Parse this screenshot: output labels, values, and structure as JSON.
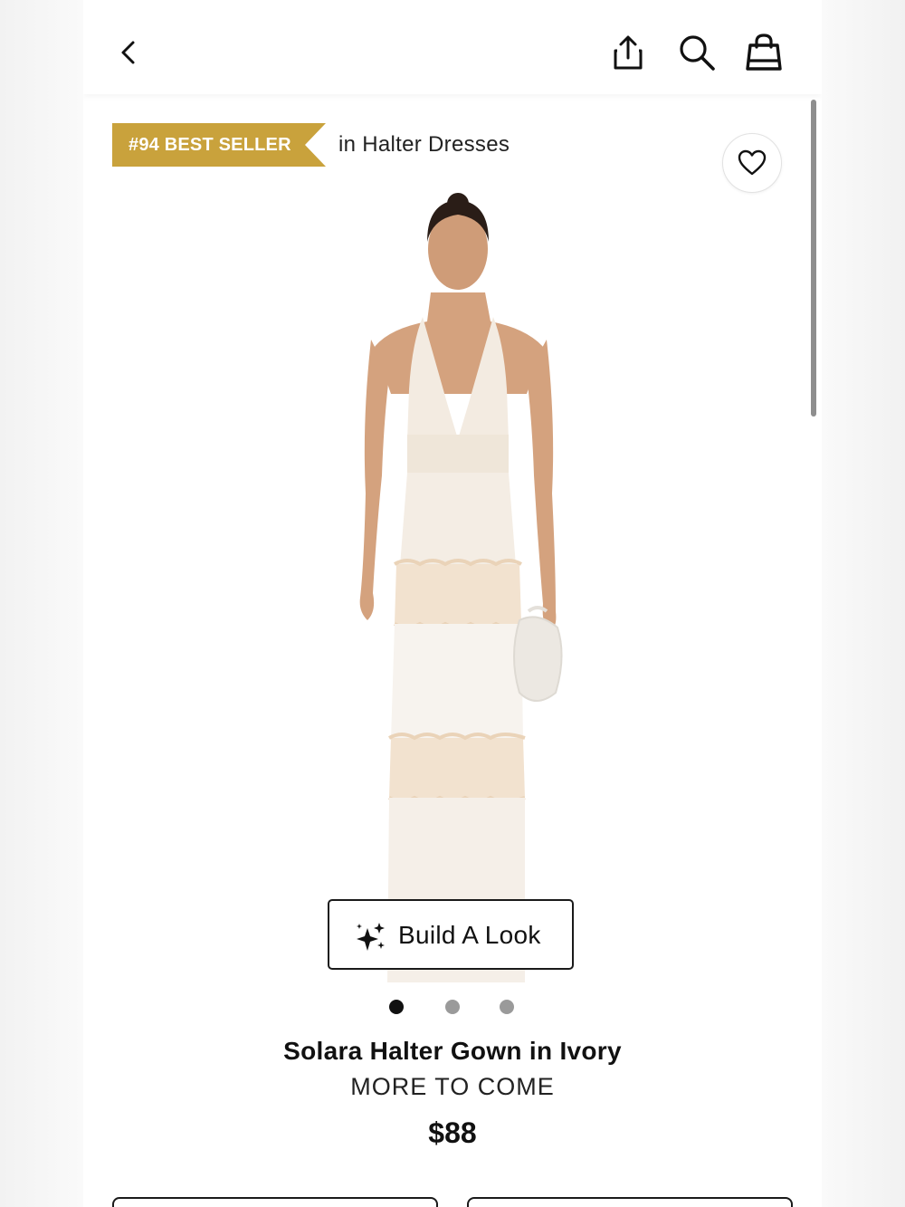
{
  "header": {
    "icons": {
      "back": "chevron-left-icon",
      "share": "share-icon",
      "search": "search-icon",
      "bag": "shopping-bag-icon"
    }
  },
  "badge": {
    "label": "#94 BEST SELLER",
    "category": "in Halter Dresses",
    "color": "#c9a23c"
  },
  "product": {
    "image_alt": "Model wearing ivory halter gown with lace tiers",
    "name": "Solara Halter Gown in Ivory",
    "brand": "MORE TO COME",
    "price": "$88"
  },
  "build_look": {
    "label": "Build A Look",
    "icon": "sparkle-icon"
  },
  "carousel": {
    "total": 3,
    "active_index": 0,
    "active_color": "#111111",
    "inactive_color": "#9a9a9a"
  }
}
